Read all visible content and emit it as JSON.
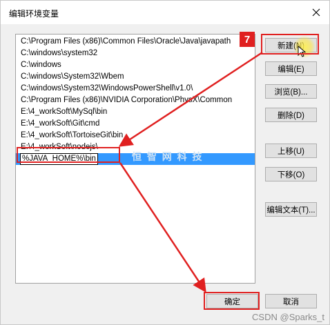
{
  "window": {
    "title": "编辑环境变量"
  },
  "paths": [
    "C:\\Program Files (x86)\\Common Files\\Oracle\\Java\\javapath",
    "C:\\windows\\system32",
    "C:\\windows",
    "C:\\windows\\System32\\Wbem",
    "C:\\windows\\System32\\WindowsPowerShell\\v1.0\\",
    "C:\\Program Files (x86)\\NVIDIA Corporation\\PhysX\\Common",
    "E:\\4_workSoft\\MySql\\bin",
    "E:\\4_workSoft\\Git\\cmd",
    "E:\\4_workSoft\\TortoiseGit\\bin",
    "E:\\4_workSoft\\nodejs\\"
  ],
  "editing_value": "%JAVA_HOME%\\bin",
  "watermark_text": "恒 智 网 科 技",
  "buttons": {
    "new": "新建(N)",
    "edit": "编辑(E)",
    "browse": "浏览(B)...",
    "delete": "删除(D)",
    "move_up": "上移(U)",
    "move_down": "下移(O)",
    "edit_text": "编辑文本(T)...",
    "ok": "确定",
    "cancel": "取消"
  },
  "annotation": {
    "step_number": "7",
    "color": "#e02020"
  },
  "credit": "CSDN @Sparks_t"
}
